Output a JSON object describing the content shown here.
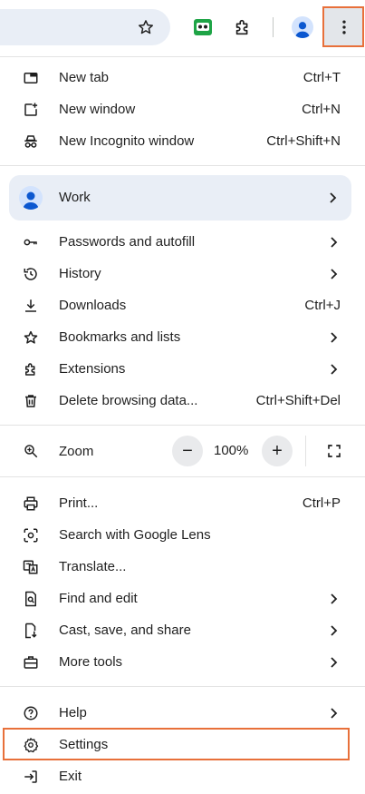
{
  "toolbar": {
    "star_icon": "star-outline-icon",
    "extension_icon": "green-robot-extension-icon",
    "puzzle_icon": "puzzle-extensions-icon",
    "profile_icon": "profile-avatar-icon",
    "menu_icon": "three-dot-menu-icon"
  },
  "menu": {
    "new_tab": {
      "label": "New tab",
      "shortcut": "Ctrl+T"
    },
    "new_window": {
      "label": "New window",
      "shortcut": "Ctrl+N"
    },
    "new_incognito": {
      "label": "New Incognito window",
      "shortcut": "Ctrl+Shift+N"
    },
    "profile": {
      "label": "Work"
    },
    "passwords": {
      "label": "Passwords and autofill"
    },
    "history": {
      "label": "History"
    },
    "downloads": {
      "label": "Downloads",
      "shortcut": "Ctrl+J"
    },
    "bookmarks": {
      "label": "Bookmarks and lists"
    },
    "extensions": {
      "label": "Extensions"
    },
    "delete_data": {
      "label": "Delete browsing data...",
      "shortcut": "Ctrl+Shift+Del"
    },
    "zoom": {
      "label": "Zoom",
      "value": "100%",
      "minus": "−",
      "plus": "+"
    },
    "print": {
      "label": "Print...",
      "shortcut": "Ctrl+P"
    },
    "lens": {
      "label": "Search with Google Lens"
    },
    "translate": {
      "label": "Translate..."
    },
    "find_edit": {
      "label": "Find and edit"
    },
    "cast": {
      "label": "Cast, save, and share"
    },
    "more_tools": {
      "label": "More tools"
    },
    "help": {
      "label": "Help"
    },
    "settings": {
      "label": "Settings"
    },
    "exit": {
      "label": "Exit"
    }
  },
  "colors": {
    "highlight": "#e8703a",
    "profile_bg": "#e9eef6",
    "avatar_blue": "#0b57d0",
    "extension_green": "#1ea446"
  }
}
